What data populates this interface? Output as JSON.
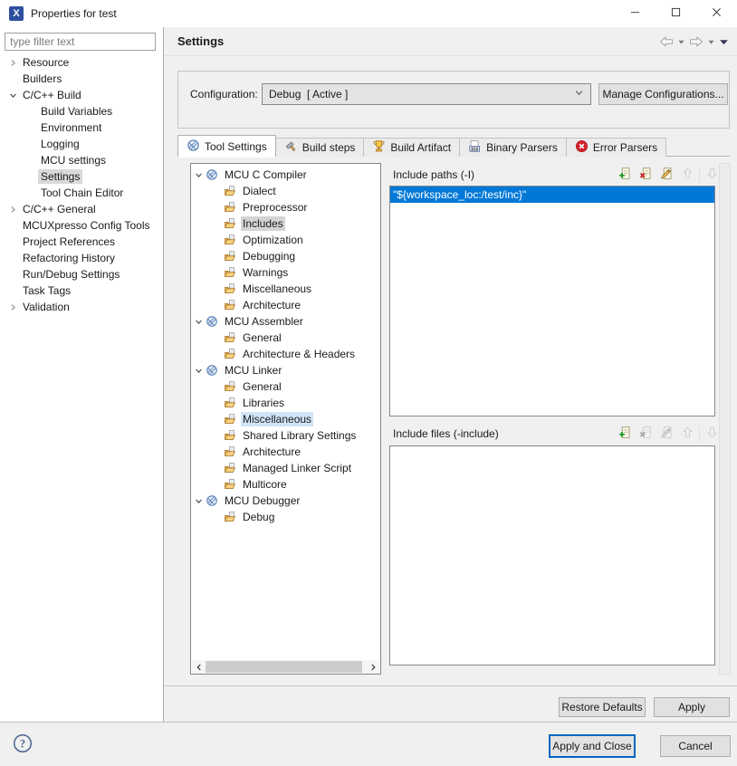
{
  "window": {
    "title": "Properties for test"
  },
  "filter": {
    "placeholder": "type filter text"
  },
  "header": {
    "title": "Settings"
  },
  "sidebar": {
    "items": [
      {
        "label": "Resource",
        "level": 0,
        "expander": "collapsed",
        "selected": false
      },
      {
        "label": "Builders",
        "level": 0,
        "expander": "none",
        "selected": false
      },
      {
        "label": "C/C++ Build",
        "level": 0,
        "expander": "expanded",
        "selected": false
      },
      {
        "label": "Build Variables",
        "level": 1,
        "expander": "none",
        "selected": false
      },
      {
        "label": "Environment",
        "level": 1,
        "expander": "none",
        "selected": false
      },
      {
        "label": "Logging",
        "level": 1,
        "expander": "none",
        "selected": false
      },
      {
        "label": "MCU settings",
        "level": 1,
        "expander": "none",
        "selected": false
      },
      {
        "label": "Settings",
        "level": 1,
        "expander": "none",
        "selected": true
      },
      {
        "label": "Tool Chain Editor",
        "level": 1,
        "expander": "none",
        "selected": false
      },
      {
        "label": "C/C++ General",
        "level": 0,
        "expander": "collapsed",
        "selected": false
      },
      {
        "label": "MCUXpresso Config Tools",
        "level": 0,
        "expander": "none",
        "selected": false
      },
      {
        "label": "Project References",
        "level": 0,
        "expander": "none",
        "selected": false
      },
      {
        "label": "Refactoring History",
        "level": 0,
        "expander": "none",
        "selected": false
      },
      {
        "label": "Run/Debug Settings",
        "level": 0,
        "expander": "none",
        "selected": false
      },
      {
        "label": "Task Tags",
        "level": 0,
        "expander": "none",
        "selected": false
      },
      {
        "label": "Validation",
        "level": 0,
        "expander": "collapsed",
        "selected": false
      }
    ]
  },
  "configuration": {
    "label": "Configuration:",
    "value": "Debug  [ Active ]",
    "manage_button": "Manage Configurations..."
  },
  "tabs": [
    {
      "label": "Tool Settings",
      "icon": "tool-icon",
      "active": true
    },
    {
      "label": "Build steps",
      "icon": "hammer-icon",
      "active": false
    },
    {
      "label": "Build Artifact",
      "icon": "trophy-icon",
      "active": false
    },
    {
      "label": "Binary Parsers",
      "icon": "binary-icon",
      "active": false
    },
    {
      "label": "Error Parsers",
      "icon": "error-icon",
      "active": false
    }
  ],
  "tool_tree": {
    "items": [
      {
        "label": "MCU C Compiler",
        "level": 0,
        "icon": "tool-icon",
        "expander": "expanded",
        "highlight": "none"
      },
      {
        "label": "Dialect",
        "level": 1,
        "icon": "folder-icon",
        "expander": "none",
        "highlight": "none"
      },
      {
        "label": "Preprocessor",
        "level": 1,
        "icon": "folder-icon",
        "expander": "none",
        "highlight": "none"
      },
      {
        "label": "Includes",
        "level": 1,
        "icon": "folder-icon",
        "expander": "none",
        "highlight": "selected"
      },
      {
        "label": "Optimization",
        "level": 1,
        "icon": "folder-icon",
        "expander": "none",
        "highlight": "none"
      },
      {
        "label": "Debugging",
        "level": 1,
        "icon": "folder-icon",
        "expander": "none",
        "highlight": "none"
      },
      {
        "label": "Warnings",
        "level": 1,
        "icon": "folder-icon",
        "expander": "none",
        "highlight": "none"
      },
      {
        "label": "Miscellaneous",
        "level": 1,
        "icon": "folder-icon",
        "expander": "none",
        "highlight": "none"
      },
      {
        "label": "Architecture",
        "level": 1,
        "icon": "folder-icon",
        "expander": "none",
        "highlight": "none"
      },
      {
        "label": "MCU Assembler",
        "level": 0,
        "icon": "tool-icon",
        "expander": "expanded",
        "highlight": "none"
      },
      {
        "label": "General",
        "level": 1,
        "icon": "folder-icon",
        "expander": "none",
        "highlight": "none"
      },
      {
        "label": "Architecture & Headers",
        "level": 1,
        "icon": "folder-icon",
        "expander": "none",
        "highlight": "none"
      },
      {
        "label": "MCU Linker",
        "level": 0,
        "icon": "tool-icon",
        "expander": "expanded",
        "highlight": "none"
      },
      {
        "label": "General",
        "level": 1,
        "icon": "folder-icon",
        "expander": "none",
        "highlight": "none"
      },
      {
        "label": "Libraries",
        "level": 1,
        "icon": "folder-icon",
        "expander": "none",
        "highlight": "none"
      },
      {
        "label": "Miscellaneous",
        "level": 1,
        "icon": "folder-icon",
        "expander": "none",
        "highlight": "hover"
      },
      {
        "label": "Shared Library Settings",
        "level": 1,
        "icon": "folder-icon",
        "expander": "none",
        "highlight": "none"
      },
      {
        "label": "Architecture",
        "level": 1,
        "icon": "folder-icon",
        "expander": "none",
        "highlight": "none"
      },
      {
        "label": "Managed Linker Script",
        "level": 1,
        "icon": "folder-icon",
        "expander": "none",
        "highlight": "none"
      },
      {
        "label": "Multicore",
        "level": 1,
        "icon": "folder-icon",
        "expander": "none",
        "highlight": "none"
      },
      {
        "label": "MCU Debugger",
        "level": 0,
        "icon": "tool-icon",
        "expander": "expanded",
        "highlight": "none"
      },
      {
        "label": "Debug",
        "level": 1,
        "icon": "folder-icon",
        "expander": "none",
        "highlight": "none"
      }
    ]
  },
  "include_paths": {
    "title": "Include paths (-I)",
    "toolbar": [
      {
        "name": "add",
        "enabled": true
      },
      {
        "name": "delete",
        "enabled": true
      },
      {
        "name": "edit",
        "enabled": true
      },
      {
        "name": "move-up",
        "enabled": false
      },
      {
        "name": "move-down",
        "enabled": false
      }
    ],
    "entries": [
      {
        "value": "\"${workspace_loc:/test/inc}\"",
        "selected": true
      }
    ]
  },
  "include_files": {
    "title": "Include files (-include)",
    "toolbar": [
      {
        "name": "add",
        "enabled": true
      },
      {
        "name": "delete",
        "enabled": false
      },
      {
        "name": "edit",
        "enabled": false
      },
      {
        "name": "move-up",
        "enabled": false
      },
      {
        "name": "move-down",
        "enabled": false
      }
    ],
    "entries": []
  },
  "action_buttons": {
    "restore_defaults": "Restore Defaults",
    "apply": "Apply",
    "apply_and_close": "Apply and Close",
    "cancel": "Cancel"
  },
  "colors": {
    "selection_blue": "#0078d7",
    "focus_border": "#0067c0",
    "dialog_gray": "#f0f0f0"
  }
}
